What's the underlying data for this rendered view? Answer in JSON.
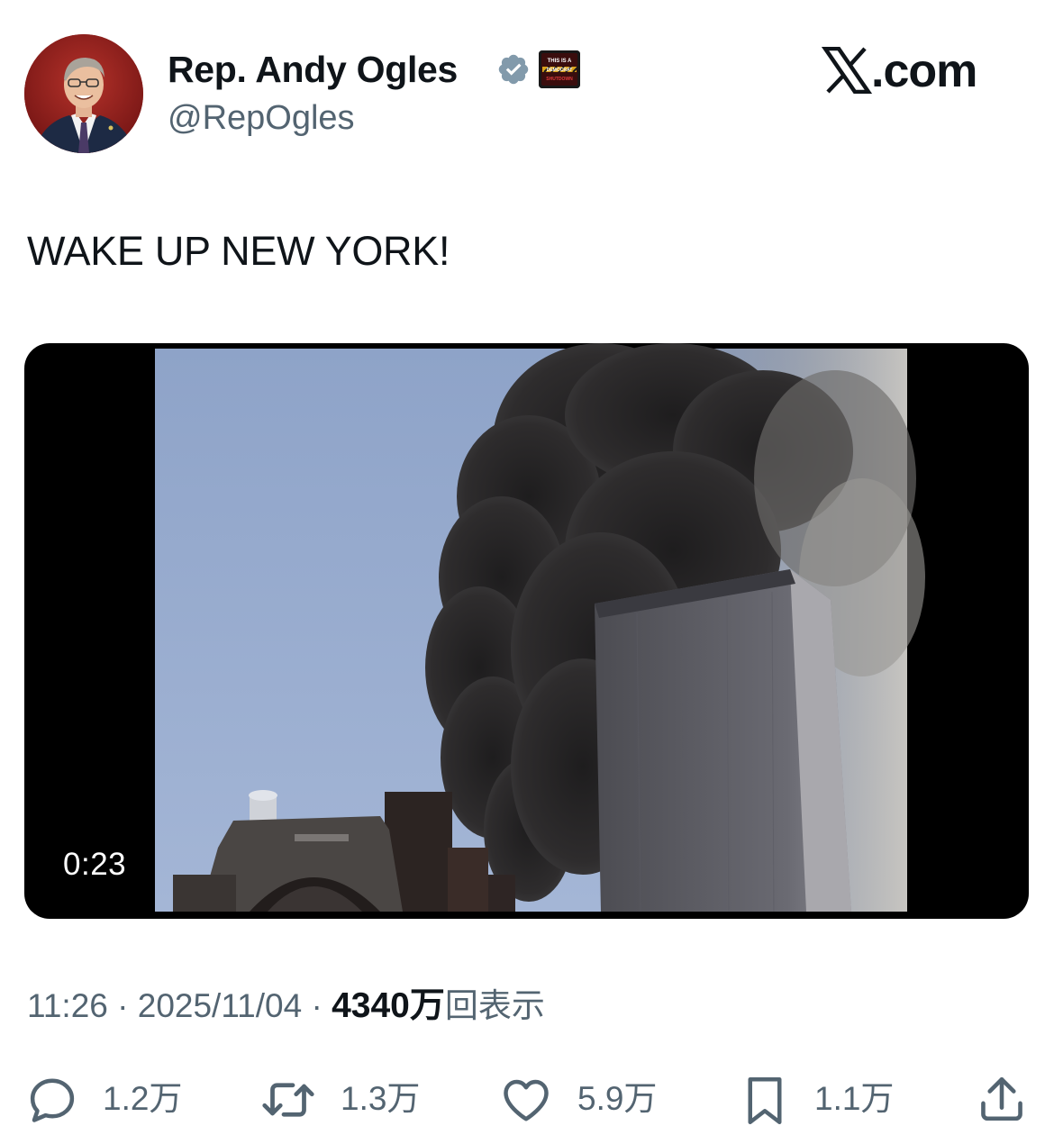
{
  "header": {
    "display_name": "Rep. Andy Ogles",
    "handle": "@RepOgles",
    "affiliation_badge_text": [
      "THIS IS A",
      "DEMOCRAT",
      "SHUTDOWN"
    ],
    "brand": "X.com",
    "brand_suffix": ".com"
  },
  "tweet": {
    "text": "WAKE UP NEW YORK!"
  },
  "media": {
    "duration": "0:23"
  },
  "meta": {
    "time": "11:26",
    "date": "2025/11/04",
    "views_count": "4340万",
    "views_label": "回表示",
    "separator": " · "
  },
  "actions": {
    "reply": {
      "icon": "reply-icon",
      "count": "1.2万"
    },
    "repost": {
      "icon": "repost-icon",
      "count": "1.3万"
    },
    "like": {
      "icon": "heart-icon",
      "count": "5.9万"
    },
    "bookmark": {
      "icon": "bookmark-icon",
      "count": "1.1万"
    },
    "share": {
      "icon": "share-icon"
    }
  },
  "colors": {
    "text_primary": "#0f1419",
    "text_secondary": "#536471",
    "verified_badge": "#829aab",
    "media_background": "#000000"
  }
}
